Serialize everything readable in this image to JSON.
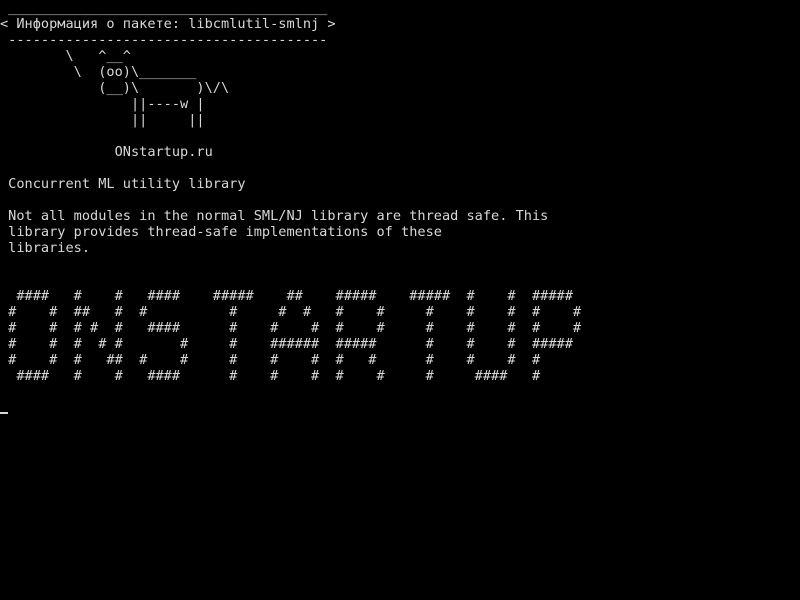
{
  "terminal": {
    "lines": [
      " _______________________________________",
      "< Информация о пакете: libcmlutil-smlnj >",
      " ---------------------------------------",
      "        \\   ^__^",
      "         \\  (oo)\\_______",
      "            (__)\\       )\\/\\",
      "                ||----w |",
      "                ||     ||",
      "",
      "              ONstartup.ru",
      "",
      " Concurrent ML utility library",
      "",
      " Not all modules in the normal SML/NJ library are thread safe. This",
      " library provides thread-safe implementations of these",
      " libraries.",
      "",
      "",
      "  ####   #    #   ####    #####    ##    #####    #####  #    #  #####",
      " #    #  ##   #  #          #     #  #   #    #     #    #    #  #    #",
      " #    #  # #  #   ####      #    #    #  #    #     #    #    #  #    #",
      " #    #  #  # #       #     #    ######  #####      #    #    #  #####",
      " #    #  #   ##  #    #     #    #    #  #   #      #    #    #  #",
      "  ####   #    #   ####      #    #    #  #    #     #     ####   #"
    ]
  }
}
